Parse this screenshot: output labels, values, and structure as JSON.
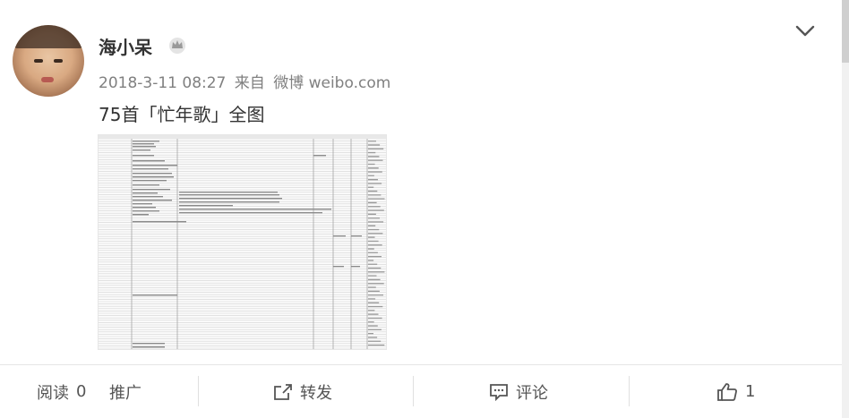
{
  "post": {
    "username": "海小呆",
    "date": "2018-3-11 08:27",
    "source_prefix": "来自",
    "source": "微博 weibo.com",
    "text": "75首「忙年歌」全图"
  },
  "actions": {
    "read_label": "阅读",
    "read_count": "0",
    "promote_label": "推广",
    "forward_label": "转发",
    "comment_label": "评论",
    "like_count": "1"
  },
  "colors": {
    "text": "#333333",
    "meta": "#808080",
    "divider": "#e6e6e6"
  },
  "icons": [
    "crown-icon",
    "chevron-down-icon",
    "forward-icon",
    "comment-icon",
    "thumbs-up-icon"
  ]
}
